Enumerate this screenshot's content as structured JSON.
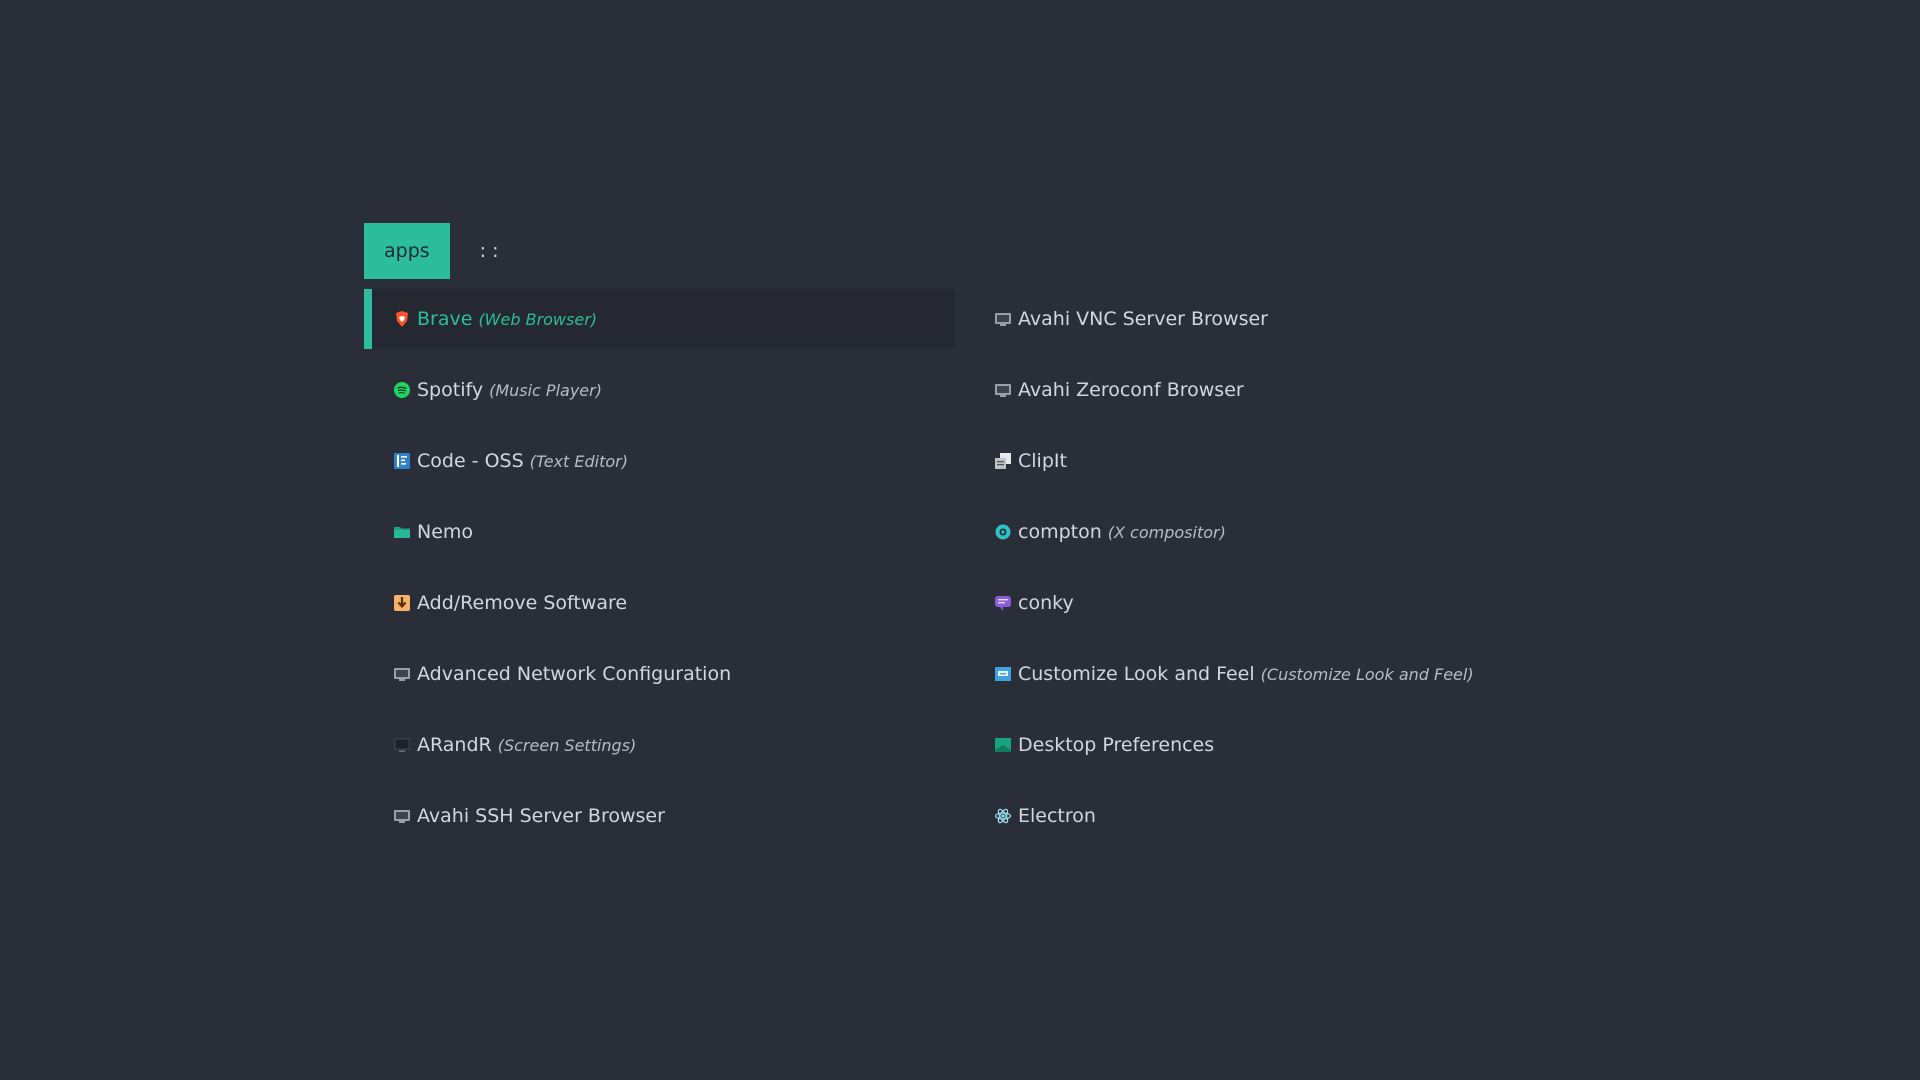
{
  "prompt": {
    "mode_label": "apps",
    "separator": ": :",
    "query": ""
  },
  "colors": {
    "background": "#2a2e39",
    "accent": "#2bbd9c",
    "text": "#d3d7de"
  },
  "entries": [
    {
      "name": "Brave",
      "generic": "(Web Browser)",
      "icon": "brave-icon",
      "selected": true
    },
    {
      "name": "Spotify",
      "generic": "(Music Player)",
      "icon": "spotify-icon"
    },
    {
      "name": "Code - OSS",
      "generic": "(Text Editor)",
      "icon": "code-oss-icon"
    },
    {
      "name": "Nemo",
      "generic": "",
      "icon": "folder-icon"
    },
    {
      "name": "Add/Remove Software",
      "generic": "",
      "icon": "package-install-icon"
    },
    {
      "name": "Advanced Network Configuration",
      "generic": "",
      "icon": "network-icon"
    },
    {
      "name": "ARandR",
      "generic": "(Screen Settings)",
      "icon": "monitor-icon"
    },
    {
      "name": "Avahi SSH Server Browser",
      "generic": "",
      "icon": "network-icon"
    },
    {
      "name": "Avahi VNC Server Browser",
      "generic": "",
      "icon": "network-icon"
    },
    {
      "name": "Avahi Zeroconf Browser",
      "generic": "",
      "icon": "network-icon"
    },
    {
      "name": "ClipIt",
      "generic": "",
      "icon": "clipboard-icon"
    },
    {
      "name": "compton",
      "generic": "(X compositor)",
      "icon": "compositor-gear-icon"
    },
    {
      "name": "conky",
      "generic": "",
      "icon": "conky-icon"
    },
    {
      "name": "Customize Look and Feel",
      "generic": "(Customize Look and Feel)",
      "icon": "appearance-icon"
    },
    {
      "name": "Desktop Preferences",
      "generic": "",
      "icon": "desktop-icon"
    },
    {
      "name": "Electron",
      "generic": "",
      "icon": "electron-icon"
    }
  ]
}
